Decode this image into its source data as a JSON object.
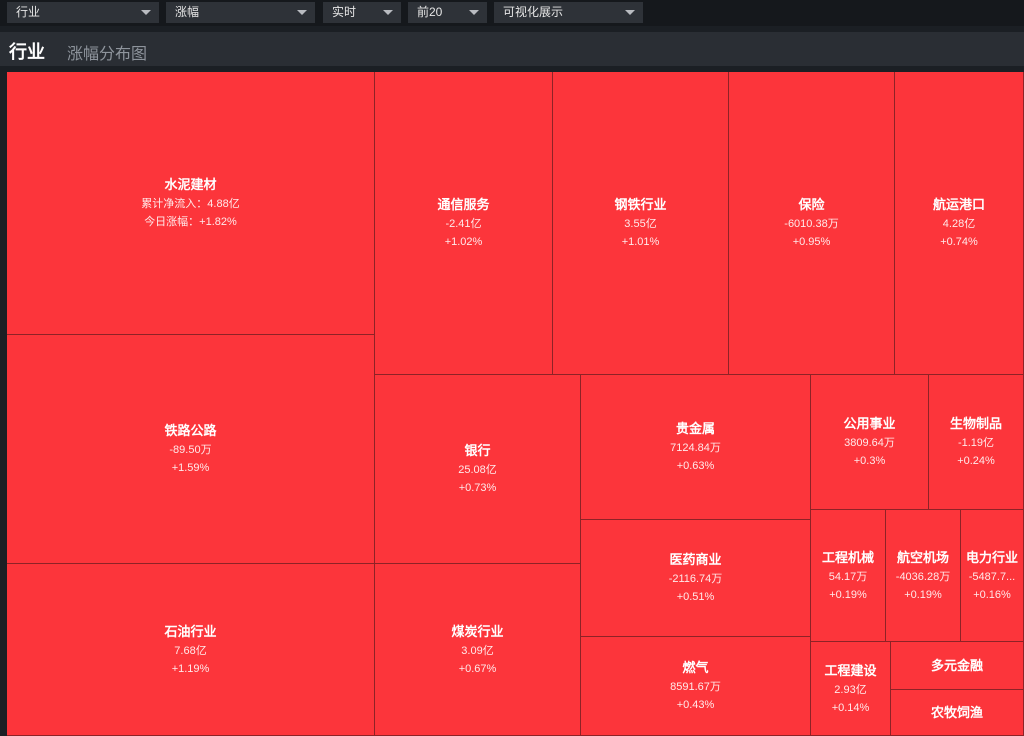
{
  "filters": [
    {
      "name": "industry",
      "value": "行业"
    },
    {
      "name": "change",
      "value": "涨幅"
    },
    {
      "name": "realtime",
      "value": "实时"
    },
    {
      "name": "top",
      "value": "前20"
    },
    {
      "name": "view",
      "value": "可视化展示"
    }
  ],
  "header": {
    "title": "行业",
    "subtitle": "涨幅分布图"
  },
  "colors": {
    "cell_up": "#fc353b",
    "background": "#1b1f24"
  },
  "chart_data": {
    "type": "treemap",
    "cells": [
      {
        "name": "水泥建材",
        "line1": "累计净流入：4.88亿",
        "line2": "今日涨幅：+1.82%",
        "change_pct": 1.82
      },
      {
        "name": "铁路公路",
        "line1": "-89.50万",
        "line2": "+1.59%",
        "change_pct": 1.59
      },
      {
        "name": "石油行业",
        "line1": "7.68亿",
        "line2": "+1.19%",
        "change_pct": 1.19
      },
      {
        "name": "通信服务",
        "line1": "-2.41亿",
        "line2": "+1.02%",
        "change_pct": 1.02
      },
      {
        "name": "钢铁行业",
        "line1": "3.55亿",
        "line2": "+1.01%",
        "change_pct": 1.01
      },
      {
        "name": "保险",
        "line1": "-6010.38万",
        "line2": "+0.95%",
        "change_pct": 0.95
      },
      {
        "name": "航运港口",
        "line1": "4.28亿",
        "line2": "+0.74%",
        "change_pct": 0.74
      },
      {
        "name": "银行",
        "line1": "25.08亿",
        "line2": "+0.73%",
        "change_pct": 0.73
      },
      {
        "name": "煤炭行业",
        "line1": "3.09亿",
        "line2": "+0.67%",
        "change_pct": 0.67
      },
      {
        "name": "贵金属",
        "line1": "7124.84万",
        "line2": "+0.63%",
        "change_pct": 0.63
      },
      {
        "name": "医药商业",
        "line1": "-2116.74万",
        "line2": "+0.51%",
        "change_pct": 0.51
      },
      {
        "name": "燃气",
        "line1": "8591.67万",
        "line2": "+0.43%",
        "change_pct": 0.43
      },
      {
        "name": "公用事业",
        "line1": "3809.64万",
        "line2": "+0.3%",
        "change_pct": 0.3
      },
      {
        "name": "生物制品",
        "line1": "-1.19亿",
        "line2": "+0.24%",
        "change_pct": 0.24
      },
      {
        "name": "工程机械",
        "line1": "54.17万",
        "line2": "+0.19%",
        "change_pct": 0.19
      },
      {
        "name": "航空机场",
        "line1": "-4036.28万",
        "line2": "+0.19%",
        "change_pct": 0.19
      },
      {
        "name": "电力行业",
        "line1": "-5487.7...",
        "line2": "+0.16%",
        "change_pct": 0.16
      },
      {
        "name": "工程建设",
        "line1": "2.93亿",
        "line2": "+0.14%",
        "change_pct": 0.14
      },
      {
        "name": "多元金融",
        "line1": "",
        "line2": ""
      },
      {
        "name": "农牧饲渔",
        "line1": "",
        "line2": ""
      }
    ]
  }
}
